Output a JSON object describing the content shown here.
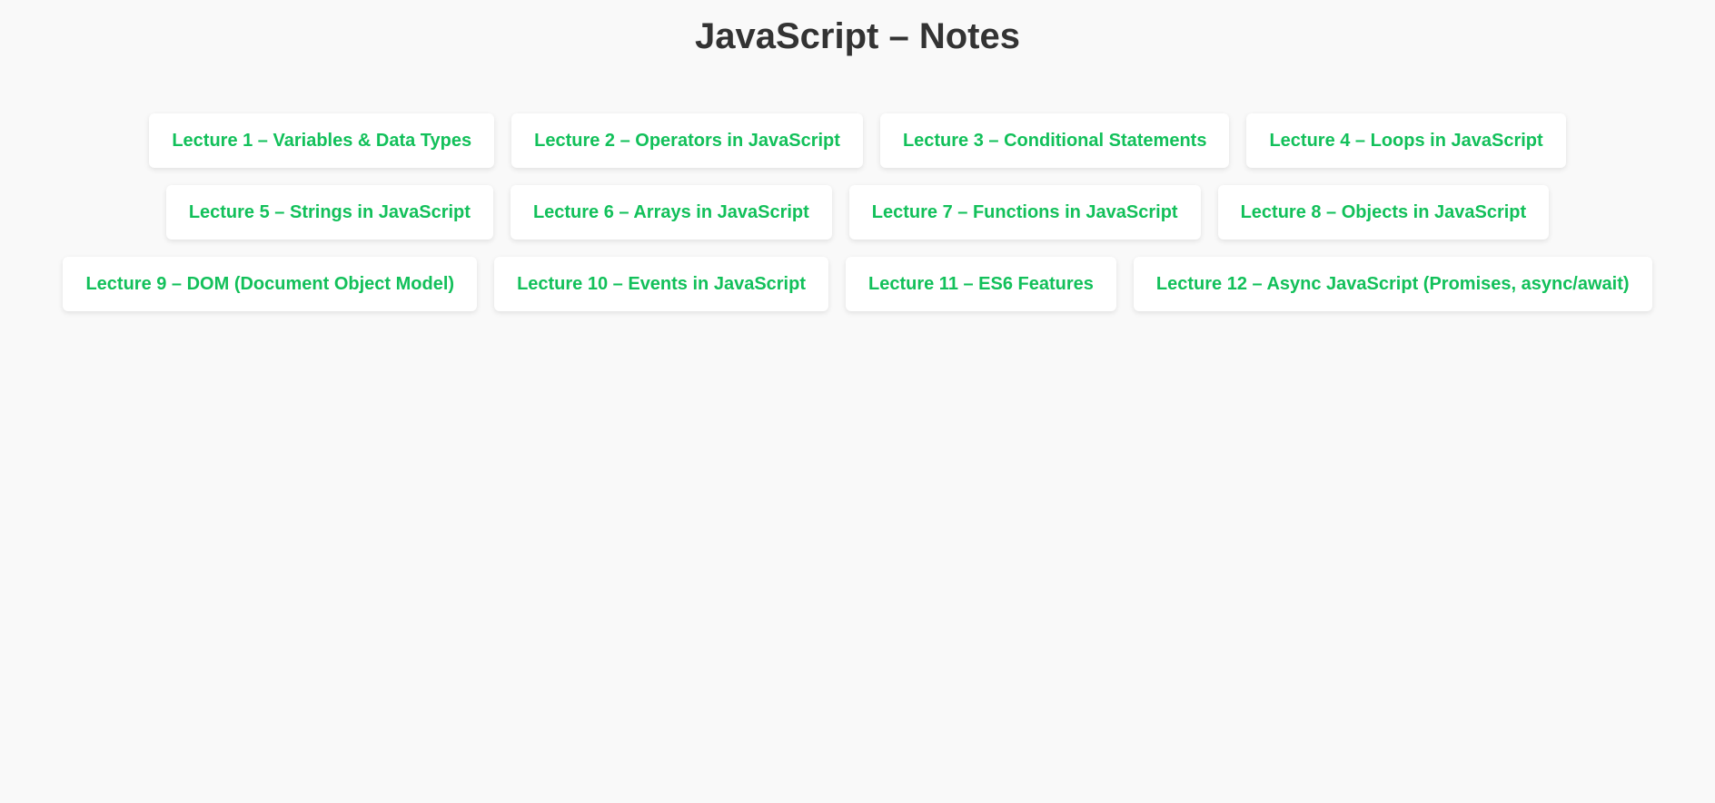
{
  "page": {
    "title": "JavaScript – Notes"
  },
  "colors": {
    "background": "#f9f9f9",
    "title": "#333333",
    "link": "#12c05a",
    "card": "#ffffff"
  },
  "lectures": [
    {
      "label": "Lecture 1 – Variables & Data Types"
    },
    {
      "label": "Lecture 2 – Operators in JavaScript"
    },
    {
      "label": "Lecture 3 – Conditional Statements"
    },
    {
      "label": "Lecture 4 – Loops in JavaScript"
    },
    {
      "label": "Lecture 5 – Strings in JavaScript"
    },
    {
      "label": "Lecture 6 – Arrays in JavaScript"
    },
    {
      "label": "Lecture 7 – Functions in JavaScript"
    },
    {
      "label": "Lecture 8 – Objects in JavaScript"
    },
    {
      "label": "Lecture 9 – DOM (Document Object Model)"
    },
    {
      "label": "Lecture 10 – Events in JavaScript"
    },
    {
      "label": "Lecture 11 – ES6 Features"
    },
    {
      "label": "Lecture 12 – Async JavaScript (Promises, async/await)"
    }
  ]
}
